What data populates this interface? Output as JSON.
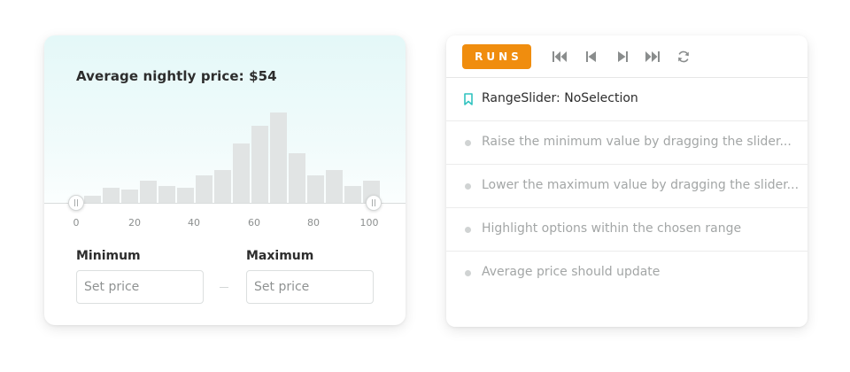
{
  "price_card": {
    "title": "Average nightly price: $54",
    "histogram": {
      "bins": [
        4,
        8,
        7,
        12,
        9,
        8,
        15,
        18,
        32,
        42,
        49,
        27,
        15,
        18,
        9,
        12
      ],
      "range": [
        0,
        100
      ]
    },
    "axis_ticks": [
      "0",
      "20",
      "40",
      "60",
      "80",
      "100"
    ],
    "slider": {
      "min_value": 0,
      "max_value": 100
    },
    "minimum": {
      "label": "Minimum",
      "placeholder": "Set price",
      "value": ""
    },
    "maximum": {
      "label": "Maximum",
      "placeholder": "Set price",
      "value": ""
    },
    "colors": {
      "bar": "#e1e4e4",
      "accent": "#31c3c0"
    }
  },
  "test_panel": {
    "runs_button": "RUNS",
    "controls": [
      "skip-back-icon",
      "step-back-icon",
      "step-forward-icon",
      "skip-forward-icon",
      "rerun-icon"
    ],
    "title": "RangeSlider: NoSelection",
    "steps": [
      "Raise the minimum value by dragging the slider...",
      "Lower the maximum value by dragging the slider...",
      "Highlight options within the chosen range",
      "Average price should update"
    ],
    "colors": {
      "runs": "#f08d0e",
      "bookmark": "#31c3c0"
    }
  }
}
